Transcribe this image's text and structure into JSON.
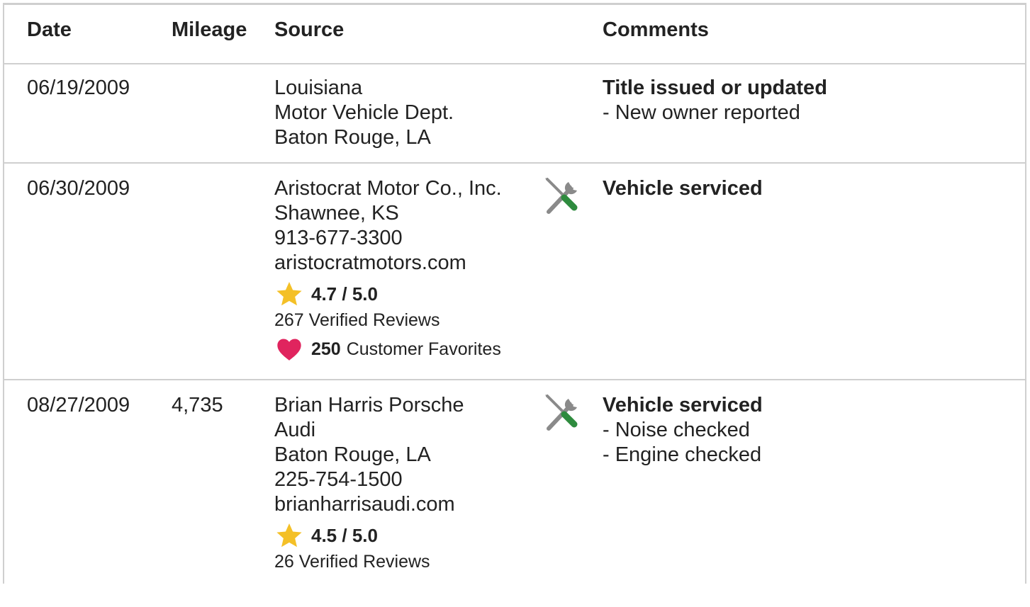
{
  "table": {
    "headers": {
      "date": "Date",
      "mileage": "Mileage",
      "source": "Source",
      "comments": "Comments"
    },
    "rows": [
      {
        "date": "06/19/2009",
        "mileage": "",
        "source_lines": [
          "Louisiana",
          "Motor Vehicle Dept.",
          "Baton Rouge, LA"
        ],
        "icon": "",
        "comment_title": "Title issued or updated",
        "comment_items": [
          "- New owner reported"
        ]
      },
      {
        "date": "06/30/2009",
        "mileage": "",
        "source_lines": [
          "Aristocrat Motor Co., Inc.",
          "Shawnee, KS",
          "913-677-3300",
          "aristocratmotors.com"
        ],
        "rating": "4.7 / 5.0",
        "reviews": "267 Verified Reviews",
        "favorites_count": "250",
        "favorites_label": "Customer Favorites",
        "icon": "service-tools-icon",
        "comment_title": "Vehicle serviced",
        "comment_items": []
      },
      {
        "date": "08/27/2009",
        "mileage": "4,735",
        "source_lines": [
          "Brian Harris Porsche",
          "Audi",
          "Baton Rouge, LA",
          "225-754-1500",
          "brianharrisaudi.com"
        ],
        "rating": "4.5 / 5.0",
        "reviews": "26 Verified Reviews",
        "icon": "service-tools-icon",
        "comment_title": "Vehicle serviced",
        "comment_items": [
          "- Noise checked",
          "- Engine checked"
        ]
      }
    ]
  },
  "colors": {
    "star": "#F4C027",
    "heart": "#E0245E",
    "wrench": "#8a8a8a",
    "screwdriver_handle": "#2E8B3E",
    "divider": "#cfcfcf"
  }
}
